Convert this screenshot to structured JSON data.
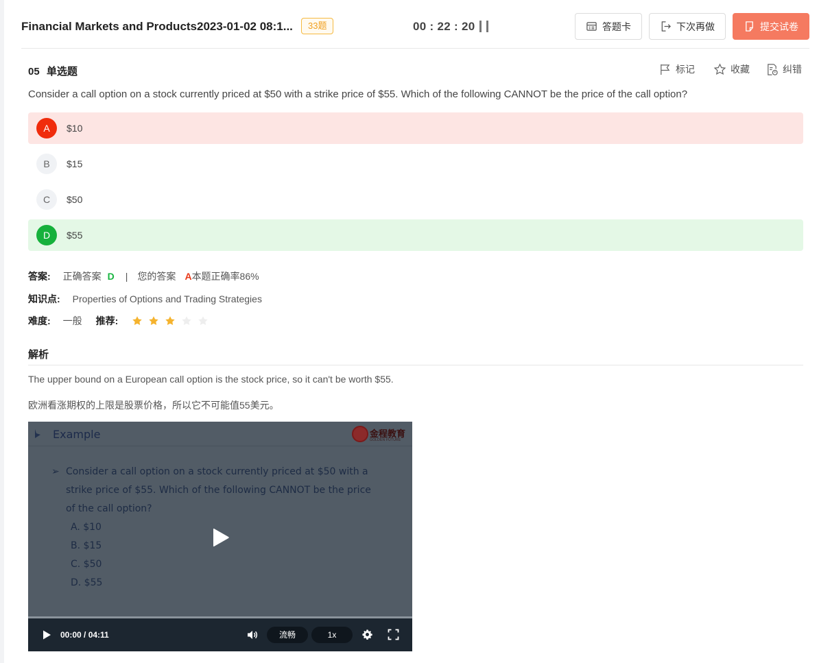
{
  "header": {
    "title": "Financial Markets and Products2023-01-02 08:1...",
    "count_badge": "33题",
    "timer": "00 : 22 : 20",
    "buttons": {
      "answer_card": "答题卡",
      "do_later": "下次再做",
      "submit": "提交试卷"
    }
  },
  "question": {
    "number": "05",
    "type": "单选题",
    "tools": {
      "mark": "标记",
      "favorite": "收藏",
      "report": "纠错"
    },
    "text": "Consider a call option on a stock currently priced at $50 with a strike price of $55. Which of the following CANNOT be the price of the call option?",
    "options": [
      {
        "letter": "A",
        "text": "$10",
        "state": "wrong"
      },
      {
        "letter": "B",
        "text": "$15",
        "state": "normal"
      },
      {
        "letter": "C",
        "text": "$50",
        "state": "normal"
      },
      {
        "letter": "D",
        "text": "$55",
        "state": "correct"
      }
    ]
  },
  "answer": {
    "label": "答案:",
    "correct_label": "正确答案",
    "correct_value": "D",
    "separator": "|",
    "yours_label": "您的答案",
    "yours_value": "A",
    "accuracy": "本题正确率86%",
    "knowledge_label": "知识点:",
    "knowledge_value": "Properties of Options and Trading Strategies",
    "difficulty_label": "难度:",
    "difficulty_value": "一般",
    "recommend_label": "推荐:",
    "recommend_stars": 3,
    "recommend_max": 5,
    "colors": {
      "correct": "#18b540",
      "wrong": "#e83a1a",
      "star_on": "#f5b32e",
      "star_off": "#eeeeee"
    }
  },
  "analysis": {
    "title": "解析",
    "en": "The upper bound on a European call option is the stock price, so it can't be worth $55.",
    "zh": "欧洲看涨期权的上限是股票价格，所以它不可能值55美元。"
  },
  "video": {
    "slide_title": "Example",
    "brand": "金程教育",
    "brand_sub": "GOLDEN FUTURE",
    "bullet": "➢",
    "slide_question": "Consider a call option on a stock currently priced at $50 with a strike price of $55. Which of the following CANNOT be the price of the call option?",
    "slide_options": [
      "A. $10",
      "B. $15",
      "C. $50",
      "D. $55"
    ],
    "time": "00:00 / 04:11",
    "quality": "流畅",
    "speed": "1x"
  }
}
